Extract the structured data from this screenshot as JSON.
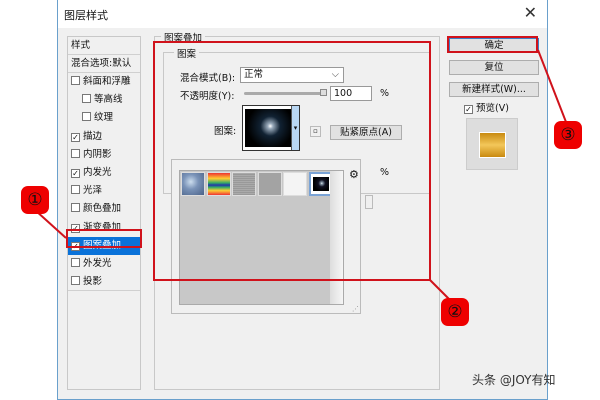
{
  "window": {
    "title": "图层样式",
    "close_icon": "close-icon"
  },
  "styles_panel": {
    "header": "样式",
    "blend_default": "混合选项:默认",
    "items": [
      {
        "label": "斜面和浮雕",
        "checked": false
      },
      {
        "label": "等高线",
        "checked": false
      },
      {
        "label": "纹理",
        "checked": false
      },
      {
        "label": "描边",
        "checked": true
      },
      {
        "label": "内阴影",
        "checked": false
      },
      {
        "label": "内发光",
        "checked": true
      },
      {
        "label": "光泽",
        "checked": false
      },
      {
        "label": "颜色叠加",
        "checked": false
      },
      {
        "label": "渐变叠加",
        "checked": true
      },
      {
        "label": "图案叠加",
        "checked": true,
        "selected": true
      },
      {
        "label": "外发光",
        "checked": false
      },
      {
        "label": "投影",
        "checked": false
      }
    ]
  },
  "pattern_overlay": {
    "group_title": "图案叠加",
    "sub_title": "图案",
    "blend_mode_label": "混合模式(B):",
    "blend_mode_value": "正常",
    "opacity_label": "不透明度(Y):",
    "opacity_value": "100",
    "opacity_unit": "%",
    "opacity_percent": 100,
    "pattern_label": "图案:",
    "snap_button": "贴紧原点(A)",
    "scale_unit": "%",
    "swatches": [
      "bubbles",
      "tie-dye",
      "gray-texture",
      "gray-flat",
      "white",
      "starfield"
    ],
    "selected_swatch": 5
  },
  "buttons": {
    "ok": "确定",
    "reset": "复位",
    "new_style": "新建样式(W)...",
    "preview_label": "预览(V)",
    "preview_checked": true
  },
  "annotations": [
    "①",
    "②",
    "③"
  ],
  "watermark": "头条 @JOY有知",
  "colors": {
    "highlight": "#d0121b",
    "selection": "#0a72d9"
  }
}
